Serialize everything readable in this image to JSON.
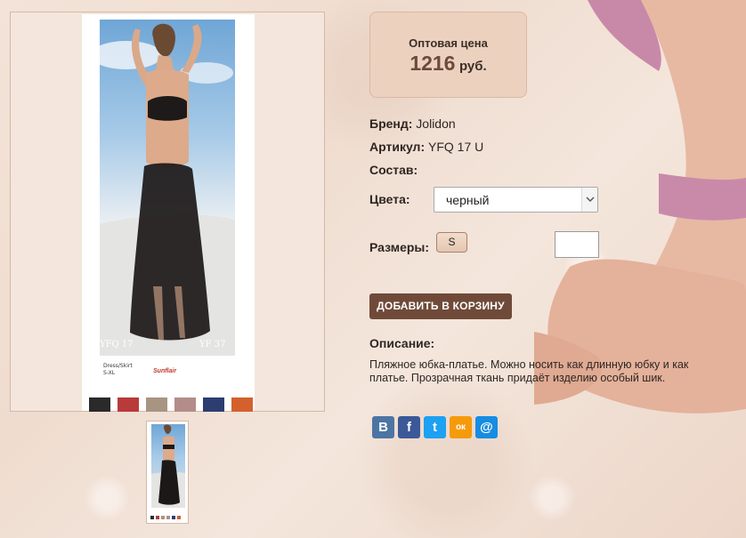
{
  "product": {
    "price_label": "Оптовая цена",
    "price_value": "1216",
    "price_currency": "руб.",
    "brand_key": "Бренд:",
    "brand_value": "Jolidon",
    "sku_key": "Артикул:",
    "sku_value": "YFQ 17 U",
    "composition_key": "Состав:",
    "colors_key": "Цвета:",
    "color_selected": "черный",
    "sizes_key": "Размеры:",
    "size_option": "S",
    "add_to_cart": "ДОБАВИТЬ В КОРЗИНУ",
    "description_key": "Описание:",
    "description": "Пляжное юбка-платье. Можно носить как длинную юбку и как платье. Прозрачная ткань придаёт изделию особый шик."
  },
  "image": {
    "caption_line1": "Dress/Skirt",
    "caption_line2": "S-XL",
    "code_left": "YFQ 17",
    "code_right": "YF 37",
    "swatch_colors": [
      "#2a2a2a",
      "#b83a3a",
      "#a89482",
      "#b48c8a",
      "#2d3d70",
      "#d4602e"
    ]
  },
  "share": {
    "icons": [
      {
        "name": "vk-icon",
        "glyph": "В",
        "color": "#4c75a3"
      },
      {
        "name": "facebook-icon",
        "glyph": "f",
        "color": "#3b5998"
      },
      {
        "name": "twitter-icon",
        "glyph": "t",
        "color": "#1da1f2"
      },
      {
        "name": "odnoklassniki-icon",
        "glyph": "ок",
        "color": "#f59a0b"
      },
      {
        "name": "mail-icon",
        "glyph": "@",
        "color": "#168de2"
      }
    ]
  }
}
